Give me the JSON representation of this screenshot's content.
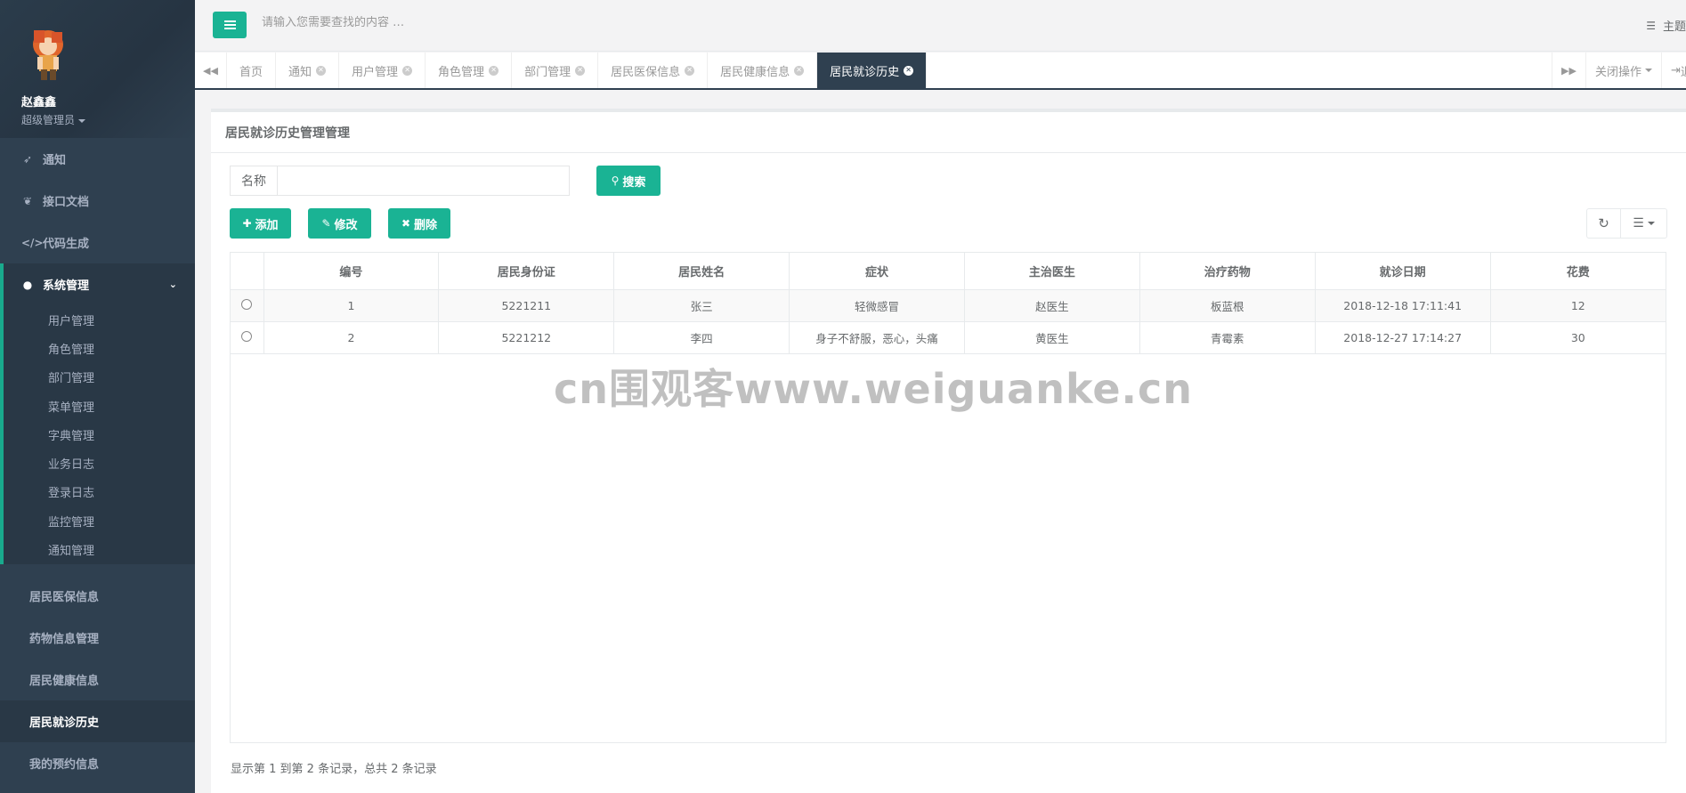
{
  "header": {
    "search_placeholder": "请输入您需要查找的内容 …",
    "theme_label": "主题"
  },
  "profile": {
    "name": "赵鑫鑫",
    "role": "超级管理员"
  },
  "sidebar": {
    "items": [
      {
        "label": "通知",
        "icon": "rocket-icon"
      },
      {
        "label": "接口文档",
        "icon": "leaf-icon"
      },
      {
        "label": "代码生成",
        "icon": "code-icon"
      }
    ],
    "group": {
      "label": "系统管理",
      "icon": "user-icon",
      "children": [
        "用户管理",
        "角色管理",
        "部门管理",
        "菜单管理",
        "字典管理",
        "业务日志",
        "登录日志",
        "监控管理",
        "通知管理"
      ]
    },
    "plain": [
      "居民医保信息",
      "药物信息管理",
      "居民健康信息",
      "居民就诊历史",
      "我的预约信息"
    ]
  },
  "tabs": {
    "items": [
      "首页",
      "通知",
      "用户管理",
      "角色管理",
      "部门管理",
      "居民医保信息",
      "居民健康信息",
      "居民就诊历史"
    ],
    "active_index": 7,
    "close_ops_label": "关闭操作",
    "logout_label": "退出"
  },
  "panel": {
    "title": "居民就诊历史管理管理",
    "search_label": "名称",
    "search_value": "",
    "search_button": "搜索",
    "add_button": "添加",
    "edit_button": "修改",
    "delete_button": "删除"
  },
  "table": {
    "columns": [
      "编号",
      "居民身份证",
      "居民姓名",
      "症状",
      "主治医生",
      "治疗药物",
      "就诊日期",
      "花费"
    ],
    "rows": [
      [
        "1",
        "5221211",
        "张三",
        "轻微感冒",
        "赵医生",
        "板蓝根",
        "2018-12-18 17:11:41",
        "12"
      ],
      [
        "2",
        "5221212",
        "李四",
        "身子不舒服，恶心，头痛",
        "黄医生",
        "青霉素",
        "2018-12-27 17:14:27",
        "30"
      ]
    ]
  },
  "pagination": {
    "info": "显示第 1 到第 2 条记录，总共 2 条记录"
  },
  "watermark": "cn围观客www.weiguanke.cn",
  "colors": {
    "accent": "#1ab394",
    "sidebar": "#2f4050",
    "sidebar_dark": "#293846"
  }
}
